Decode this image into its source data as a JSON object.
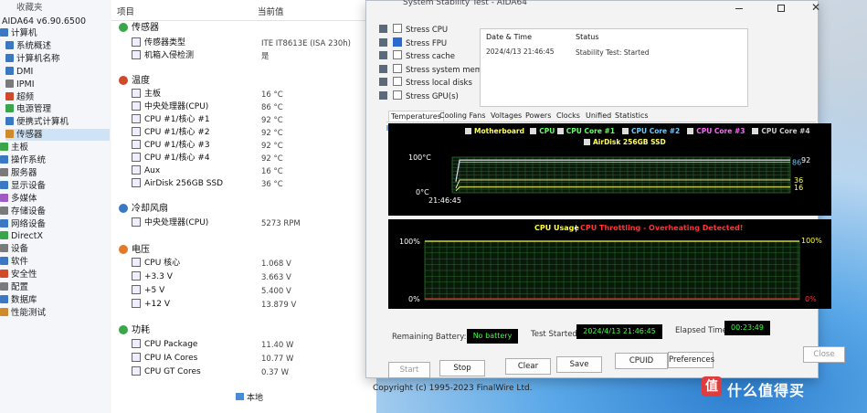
{
  "left_tree": {
    "header": "收藏夹",
    "app": "AIDA64 v6.90.6500",
    "items": [
      {
        "label": "计算机",
        "depth": 0,
        "color": "#3a78c4"
      },
      {
        "label": "系统概述",
        "depth": 1,
        "color": "#3a78c4"
      },
      {
        "label": "计算机名称",
        "depth": 1,
        "color": "#3a78c4"
      },
      {
        "label": "DMI",
        "depth": 1,
        "color": "#3a78c4"
      },
      {
        "label": "IPMI",
        "depth": 1,
        "color": "#7a7a7a"
      },
      {
        "label": "超频",
        "depth": 1,
        "color": "#d04a2a"
      },
      {
        "label": "电源管理",
        "depth": 1,
        "color": "#3aa64a"
      },
      {
        "label": "便携式计算机",
        "depth": 1,
        "color": "#3a78c4"
      },
      {
        "label": "传感器",
        "depth": 1,
        "color": "#d08a2a"
      },
      {
        "label": "主板",
        "depth": 0,
        "color": "#3aa64a"
      },
      {
        "label": "操作系统",
        "depth": 0,
        "color": "#3a78c4"
      },
      {
        "label": "服务器",
        "depth": 0,
        "color": "#7a7a7a"
      },
      {
        "label": "显示设备",
        "depth": 0,
        "color": "#3a78c4"
      },
      {
        "label": "多媒体",
        "depth": 0,
        "color": "#a05ac4"
      },
      {
        "label": "存储设备",
        "depth": 0,
        "color": "#7a7a7a"
      },
      {
        "label": "网络设备",
        "depth": 0,
        "color": "#3a78c4"
      },
      {
        "label": "DirectX",
        "depth": 0,
        "color": "#3aa64a"
      },
      {
        "label": "设备",
        "depth": 0,
        "color": "#7a7a7a"
      },
      {
        "label": "软件",
        "depth": 0,
        "color": "#3a78c4"
      },
      {
        "label": "安全性",
        "depth": 0,
        "color": "#d04a2a"
      },
      {
        "label": "配置",
        "depth": 0,
        "color": "#7a7a7a"
      },
      {
        "label": "数据库",
        "depth": 0,
        "color": "#3a78c4"
      },
      {
        "label": "性能测试",
        "depth": 0,
        "color": "#d08a2a"
      }
    ]
  },
  "sensor_panel": {
    "col_item": "项目",
    "col_value": "当前值",
    "groups": [
      {
        "title": "传感器",
        "rows": [
          {
            "label": "传感器类型",
            "value": "ITE IT8613E (ISA 230h)"
          },
          {
            "label": "机箱入侵检测",
            "value": "是"
          }
        ]
      },
      {
        "title": "温度",
        "rows": [
          {
            "label": "主板",
            "value": "16 °C"
          },
          {
            "label": "中央处理器(CPU)",
            "value": "86 °C"
          },
          {
            "label": "CPU #1/核心 #1",
            "value": "92 °C"
          },
          {
            "label": "CPU #1/核心 #2",
            "value": "92 °C"
          },
          {
            "label": "CPU #1/核心 #3",
            "value": "92 °C"
          },
          {
            "label": "CPU #1/核心 #4",
            "value": "92 °C"
          },
          {
            "label": "Aux",
            "value": "16 °C"
          },
          {
            "label": "AirDisk 256GB SSD",
            "value": "36 °C"
          }
        ]
      },
      {
        "title": "冷却风扇",
        "rows": [
          {
            "label": "中央处理器(CPU)",
            "value": "5273 RPM"
          }
        ]
      },
      {
        "title": "电压",
        "rows": [
          {
            "label": "CPU 核心",
            "value": "1.068 V"
          },
          {
            "label": "+3.3 V",
            "value": "3.663 V"
          },
          {
            "label": "+5 V",
            "value": "5.400 V"
          },
          {
            "label": "+12 V",
            "value": "13.879 V"
          }
        ]
      },
      {
        "title": "功耗",
        "rows": [
          {
            "label": "CPU Package",
            "value": "11.40 W"
          },
          {
            "label": "CPU IA Cores",
            "value": "10.77 W"
          },
          {
            "label": "CPU GT Cores",
            "value": "0.37 W"
          }
        ]
      }
    ],
    "status_left": "本地",
    "copyright": "Copyright (c) 1995-2023 FinalWire Ltd."
  },
  "stability": {
    "title": "System Stability Test - AIDA64",
    "checks": [
      {
        "label": "Stress CPU",
        "on": false
      },
      {
        "label": "Stress FPU",
        "on": true
      },
      {
        "label": "Stress cache",
        "on": false
      },
      {
        "label": "Stress system memory",
        "on": false
      },
      {
        "label": "Stress local disks",
        "on": false
      },
      {
        "label": "Stress GPU(s)",
        "on": false
      }
    ],
    "log_head_date": "Date & Time",
    "log_head_status": "Status",
    "log_date": "2024/4/13 21:46:45",
    "log_status": "Stability Test: Started",
    "tabs": [
      "Temperatures",
      "Cooling Fans",
      "Voltages",
      "Powers",
      "Clocks",
      "Unified",
      "Statistics"
    ],
    "temp_legend": [
      {
        "label": "Motherboard",
        "color": "#ffff66"
      },
      {
        "label": "CPU",
        "color": "#66ff66"
      },
      {
        "label": "CPU Core #1",
        "color": "#66ff66"
      },
      {
        "label": "CPU Core #2",
        "color": "#66ccff"
      },
      {
        "label": "CPU Core #3",
        "color": "#ff66ff"
      },
      {
        "label": "CPU Core #4",
        "color": "#cccccc"
      }
    ],
    "temp_legend2": {
      "label": "AirDisk 256GB SSD",
      "color": "#ffff66"
    },
    "temp_ymax": "100°C",
    "temp_ymin": "0°C",
    "temp_time": "21:46:45",
    "temp_right": [
      {
        "label": "86",
        "color": "#66ccff"
      },
      {
        "label": "92",
        "color": "#ffffff"
      },
      {
        "label": "36",
        "color": "#ffff66"
      },
      {
        "label": "16",
        "color": "#ffff66"
      }
    ],
    "cpu_title": "CPU Usage",
    "cpu_sep": "|",
    "cpu_throttle": "CPU Throttling - Overheating Detected!",
    "cpu_ymax": "100%",
    "cpu_ymin": "0%",
    "cpu_right_max": "100%",
    "cpu_right_min": "0%",
    "battery_label": "Remaining Battery:",
    "battery_value": "No battery",
    "started_label": "Test Started:",
    "started_value": "2024/4/13 21:46:45",
    "elapsed_label": "Elapsed Time:",
    "elapsed_value": "00:23:49",
    "buttons": {
      "start": "Start",
      "stop": "Stop",
      "clear": "Clear",
      "save": "Save",
      "cpuid": "CPUID",
      "preferences": "Preferences",
      "close": "Close"
    }
  },
  "chart_data": [
    {
      "type": "line",
      "title": "Temperatures",
      "ylim": [
        0,
        100
      ],
      "x": [
        "21:46:45"
      ],
      "series": [
        {
          "name": "Motherboard",
          "values": [
            16
          ]
        },
        {
          "name": "CPU",
          "values": [
            86
          ]
        },
        {
          "name": "CPU Core #1",
          "values": [
            92
          ]
        },
        {
          "name": "CPU Core #2",
          "values": [
            92
          ]
        },
        {
          "name": "CPU Core #3",
          "values": [
            92
          ]
        },
        {
          "name": "CPU Core #4",
          "values": [
            92
          ]
        },
        {
          "name": "AirDisk 256GB SSD",
          "values": [
            36
          ]
        }
      ]
    },
    {
      "type": "line",
      "title": "CPU Usage",
      "ylim": [
        0,
        100
      ],
      "series": [
        {
          "name": "CPU Usage",
          "values": [
            100
          ]
        },
        {
          "name": "CPU Throttling",
          "values": [
            0
          ]
        }
      ]
    }
  ]
}
